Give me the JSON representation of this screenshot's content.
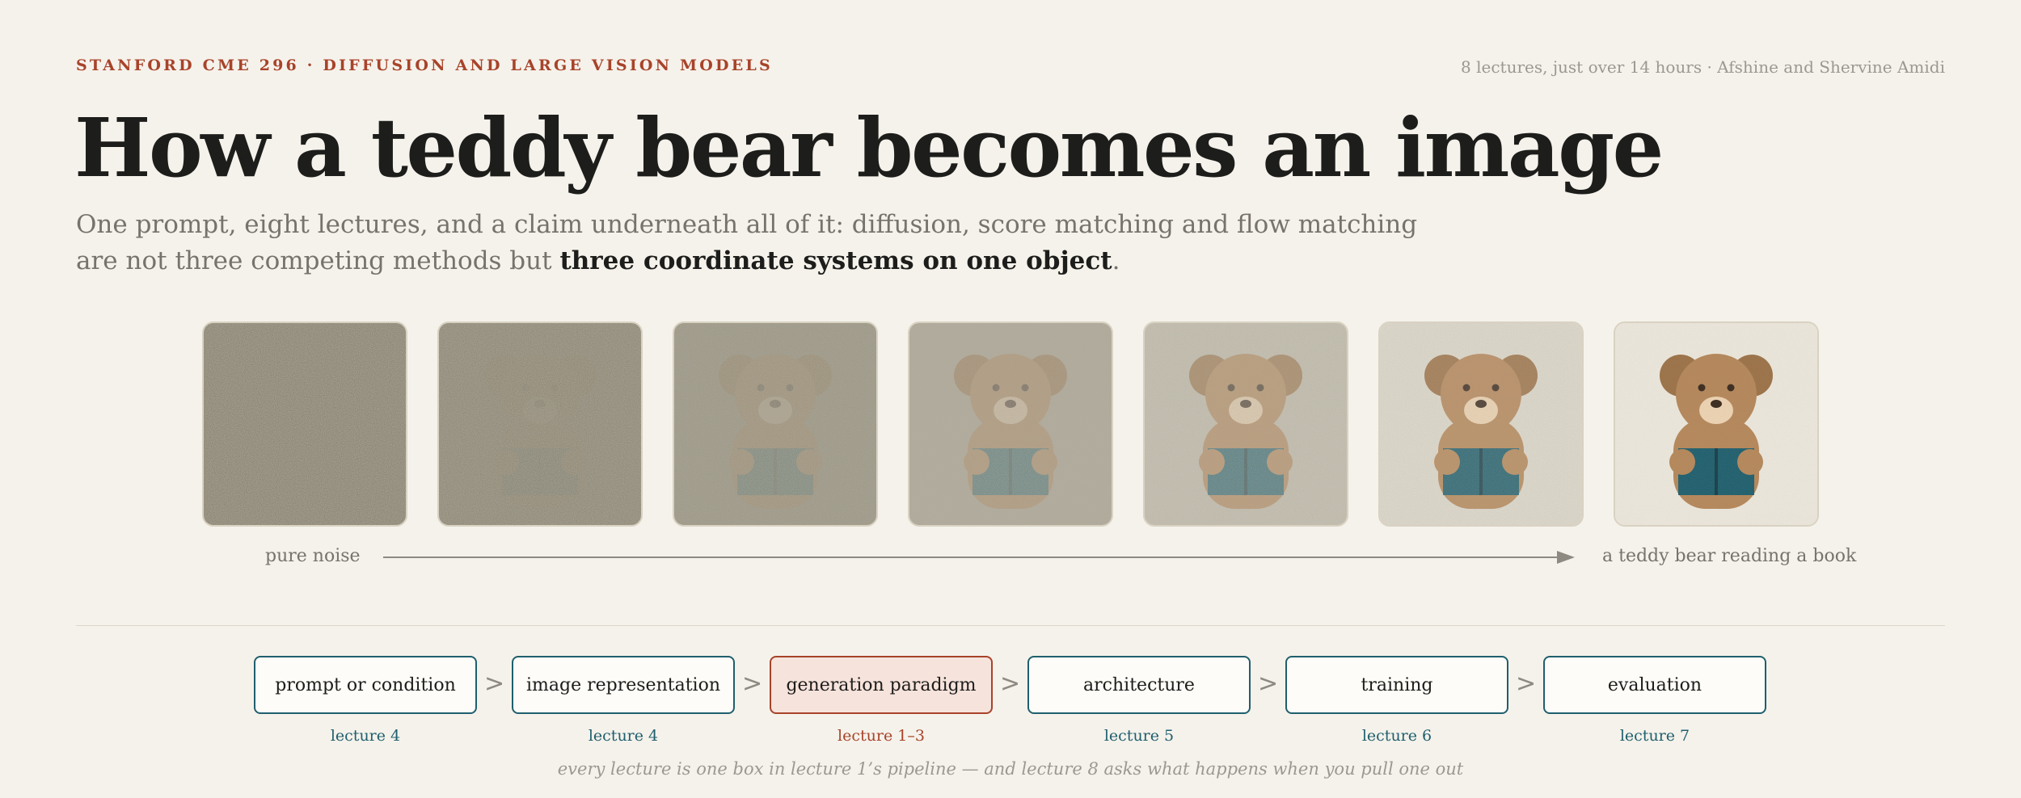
{
  "header": {
    "kicker": "STANFORD CME 296 · DIFFUSION AND LARGE VISION MODELS",
    "meta": "8 lectures, just over 14 hours · Afshine and Shervine Amidi"
  },
  "hero": {
    "title": "How a teddy bear becomes an image",
    "subtitle_before": "One prompt, eight lectures, and a claim underneath all of it: diffusion, score matching and flow matching are not three competing methods but ",
    "subtitle_bold": "three coordinate systems on one object",
    "subtitle_after": "."
  },
  "denoising": {
    "frames": [
      {
        "noise_level": 1.0
      },
      {
        "noise_level": 0.95
      },
      {
        "noise_level": 0.8
      },
      {
        "noise_level": 0.6
      },
      {
        "noise_level": 0.4
      },
      {
        "noise_level": 0.15
      },
      {
        "noise_level": 0.0
      }
    ],
    "caption_start": "pure noise",
    "caption_end": "a teddy bear reading a book",
    "colors": {
      "noise": "#8b8573",
      "bear_fur": "#b5875a",
      "bear_ear": "#9c7248",
      "bear_muzzle": "#edd3b2",
      "bear_eye": "#3a2a1e",
      "book": "#1f5f6e",
      "book_spine": "#173f49"
    }
  },
  "pipeline": {
    "steps": [
      {
        "label": "prompt or condition",
        "lecture": "lecture 4",
        "active": false
      },
      {
        "label": "image representation",
        "lecture": "lecture 4",
        "active": false
      },
      {
        "label": "generation paradigm",
        "lecture": "lecture 1–3",
        "active": true
      },
      {
        "label": "architecture",
        "lecture": "lecture 5",
        "active": false
      },
      {
        "label": "training",
        "lecture": "lecture 6",
        "active": false
      },
      {
        "label": "evaluation",
        "lecture": "lecture 7",
        "active": false
      }
    ],
    "separator": ">",
    "footer": "every lecture is one box in lecture 1’s pipeline — and lecture 8 asks what happens when you pull one out"
  },
  "colors": {
    "background": "#f5f2eb",
    "accent": "#a8432a",
    "teal": "#1f5f6e",
    "muted": "#76736c"
  }
}
